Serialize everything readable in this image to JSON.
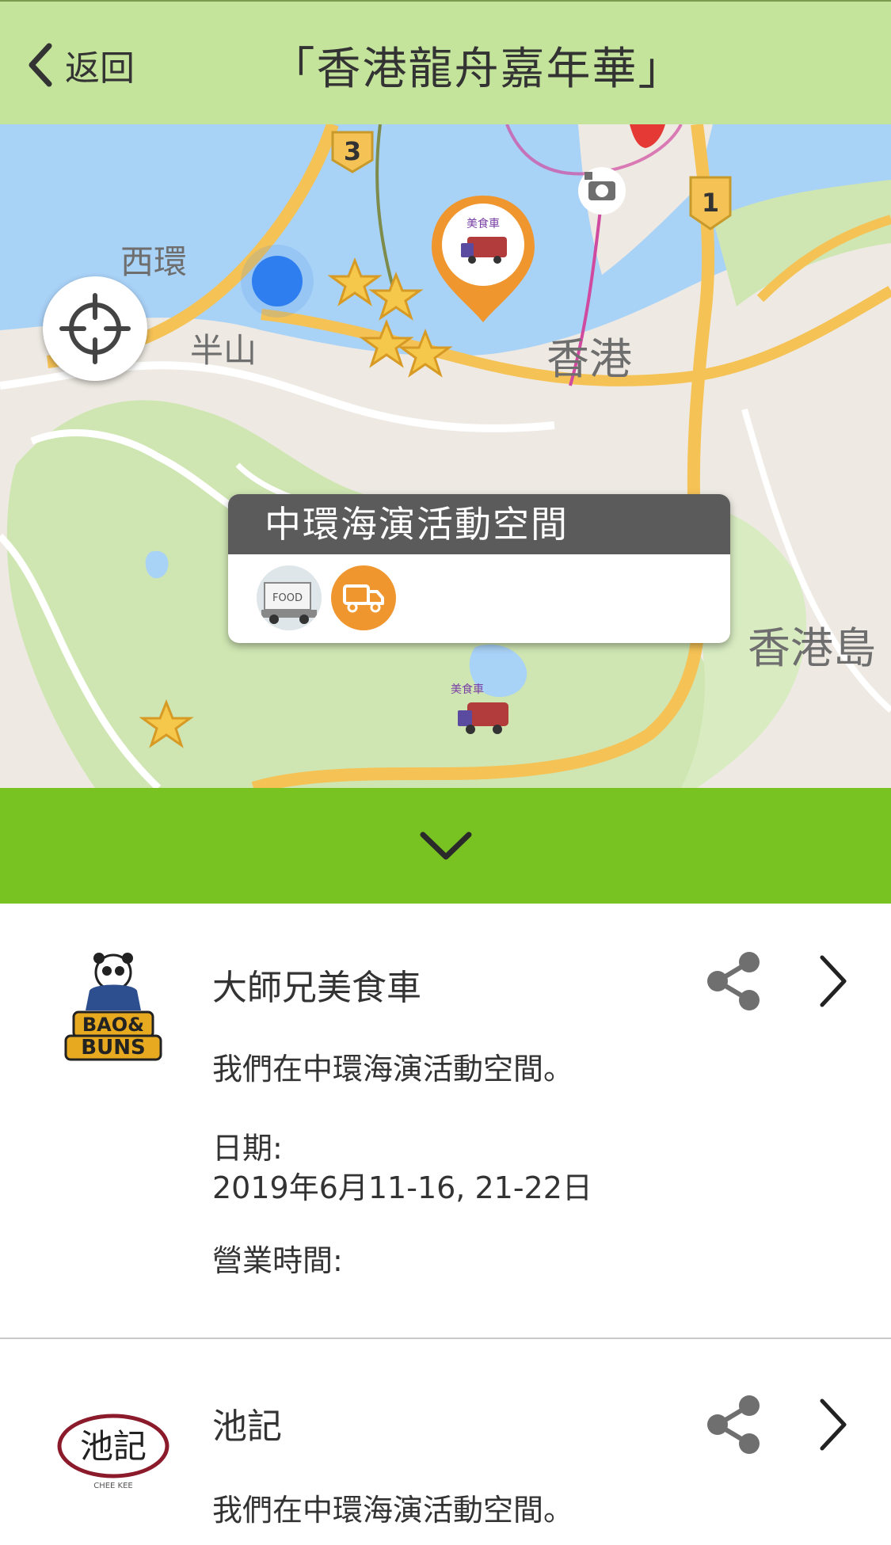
{
  "header": {
    "back_label": "返回",
    "title": "「香港龍舟嘉年華」"
  },
  "map": {
    "labels": {
      "sai_wan": "西環",
      "mid_levels": "半山",
      "hong_kong": "香港",
      "hk_island": "香港島"
    },
    "route_badges": [
      "3",
      "1",
      "1"
    ],
    "popup": {
      "title": "中環海演活動空間"
    },
    "thumb_text": "FOOD",
    "pin_brand": "美食車"
  },
  "list": {
    "items": [
      {
        "name": "大師兄美食車",
        "logo_text": [
          "BAO&",
          "BUNS"
        ],
        "desc": "我們在中環海演活動空間。",
        "date_label": "日期:",
        "date_value": "2019年6月11-16, 21-22日",
        "hours_label": "營業時間:"
      },
      {
        "name": "池記",
        "logo_text": [
          "池記",
          "CHEE KEE"
        ],
        "desc": "我們在中環海演活動空間。"
      }
    ]
  },
  "colors": {
    "header": "#c4e39b",
    "bar": "#78c321",
    "accent": "#f0962e",
    "popup_head": "#5b5b5b"
  }
}
